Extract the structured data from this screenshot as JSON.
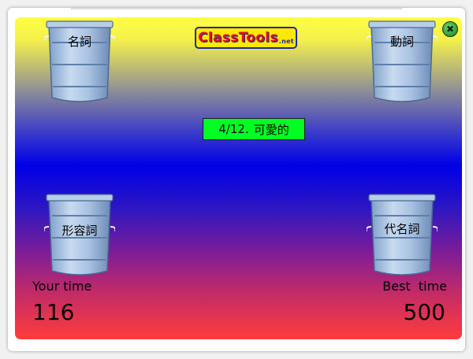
{
  "app": {
    "logo_text": "ClassTools",
    "logo_suffix": ".net"
  },
  "bins": [
    {
      "label": "名詞",
      "position": "top-left"
    },
    {
      "label": "動詞",
      "position": "top-right"
    },
    {
      "label": "形容詞",
      "position": "bottom-left"
    },
    {
      "label": "代名詞",
      "position": "bottom-right"
    }
  ],
  "current_word": {
    "counter": "4/12.",
    "text": "可愛的"
  },
  "stats": {
    "your_time_label": "Your time",
    "your_time_value": "116",
    "best_time_label": "Best  time",
    "best_time_value": "500"
  },
  "colors": {
    "word_box": "#00ff22",
    "close_button": "#2a8a2a",
    "gradient_top": "#ffff44",
    "gradient_middle": "#0000e6",
    "gradient_bottom": "#ff3c3c"
  },
  "icons": {
    "close": "close-icon"
  }
}
